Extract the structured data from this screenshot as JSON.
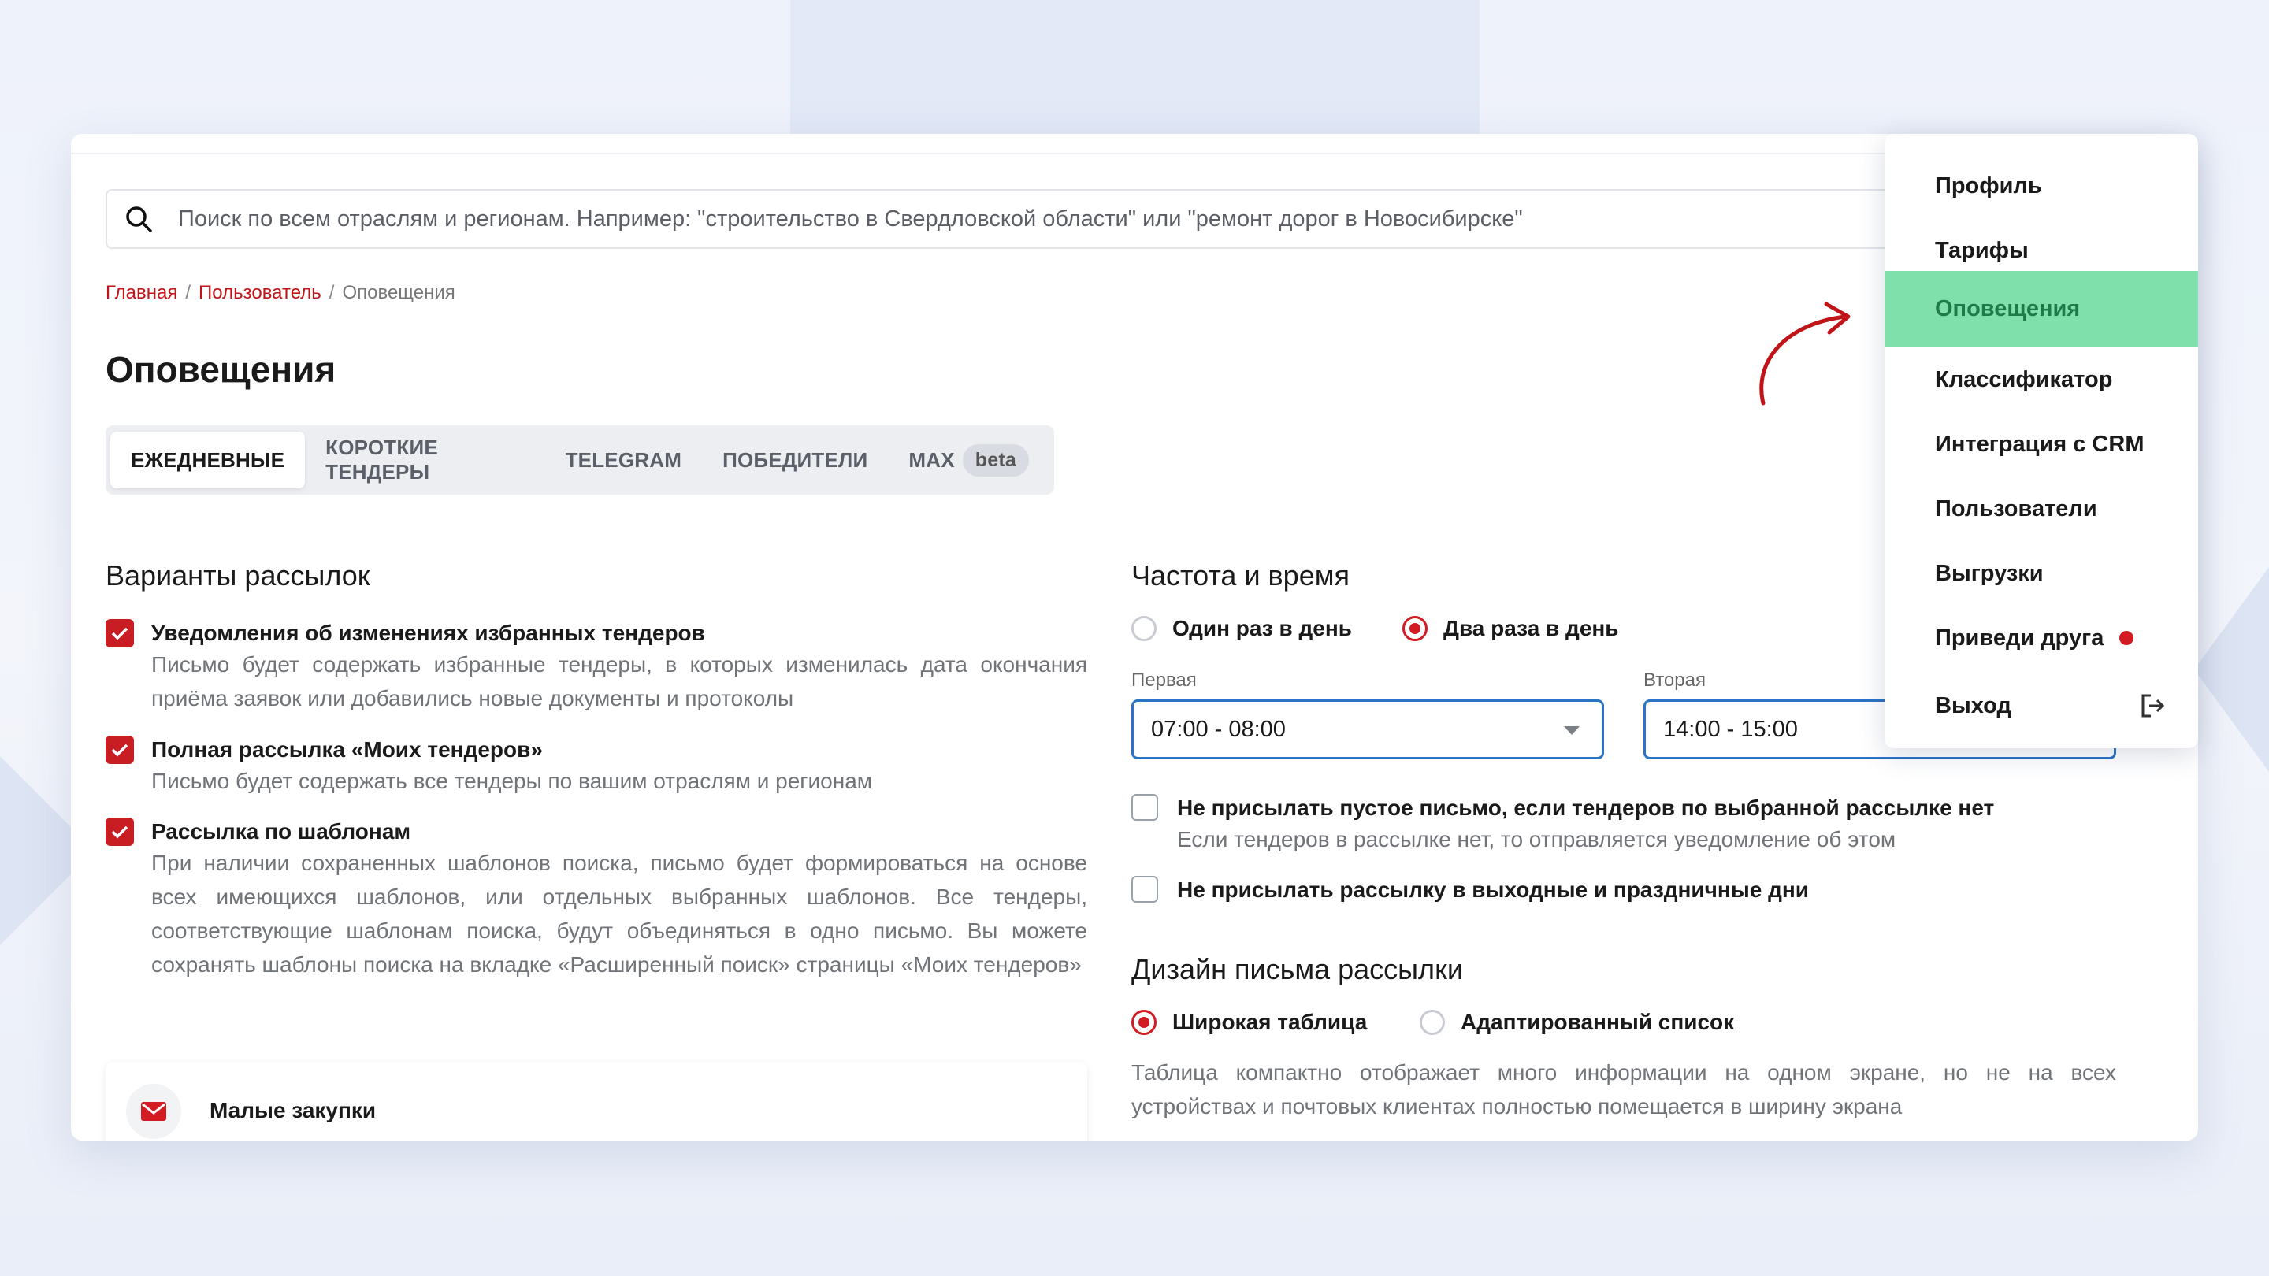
{
  "search": {
    "placeholder": "Поиск по всем отраслям и регионам. Например: \"строительство в Свердловской области\" или \"ремонт дорог в Новосибирске\""
  },
  "breadcrumb": {
    "items": [
      "Главная",
      "Пользователь",
      "Оповещения"
    ],
    "separator": "/"
  },
  "page": {
    "title": "Оповещения"
  },
  "tabs": [
    {
      "label": "ЕЖЕДНЕВНЫЕ",
      "active": true
    },
    {
      "label": "КОРОТКИЕ ТЕНДЕРЫ"
    },
    {
      "label": "TELEGRAM"
    },
    {
      "label": "ПОБЕДИТЕЛИ"
    },
    {
      "label": "MAX",
      "badge": "beta"
    }
  ],
  "mailing": {
    "title": "Варианты рассылок",
    "options": [
      {
        "title": "Уведомления об изменениях избранных тендеров",
        "desc": "Письмо будет содержать избранные тендеры, в которых изменилась дата окончания приёма заявок или добавились новые документы и протоколы",
        "checked": true
      },
      {
        "title": "Полная рассылка «Моих тендеров»",
        "desc": "Письмо будет содержать все тендеры по вашим отраслям и регионам",
        "checked": true
      },
      {
        "title": "Рассылка по шаблонам",
        "desc": "При наличии сохраненных шаблонов поиска, письмо будет формироваться на основе всех имеющихся шаблонов, или отдельных выбранных шаблонов. Все тендеры, соответствующие шаблонам поиска, будут объединяться в одно письмо. Вы можете сохранять шаблоны поиска на вкладке «Расширенный поиск» страницы «Моих тендеров»",
        "checked": true
      }
    ],
    "card_label": "Малые закупки"
  },
  "frequency": {
    "title": "Частота и время",
    "radio_once": "Один раз в день",
    "radio_twice": "Два раза в день",
    "first_label": "Первая",
    "first_value": "07:00 - 08:00",
    "second_label": "Вторая",
    "second_value": "14:00 - 15:00",
    "no_empty_title": "Не присылать пустое письмо, если тендеров по выбранной рассылке нет",
    "no_empty_desc": "Если тендеров в рассылке нет, то отправляется уведомление об этом",
    "no_weekends_title": "Не присылать рассылку в выходные и праздничные дни"
  },
  "design": {
    "title": "Дизайн письма рассылки",
    "radio_wide": "Широкая таблица",
    "radio_adaptive": "Адаптированный список",
    "desc": "Таблица компактно отображает много информации на одном экране, но не на всех устройствах и почтовых клиентах полностью помещается в ширину экрана"
  },
  "menu": {
    "items": [
      "Профиль",
      "Тарифы",
      "Оповещения",
      "Классификатор",
      "Интеграция с CRM",
      "Пользователи",
      "Выгрузки",
      "Приведи друга",
      "Выход"
    ],
    "active": "Оповещения"
  },
  "colors": {
    "accent_red": "#c81e23",
    "menu_active_bg": "#80e0ac",
    "select_border": "#2a73c5"
  }
}
